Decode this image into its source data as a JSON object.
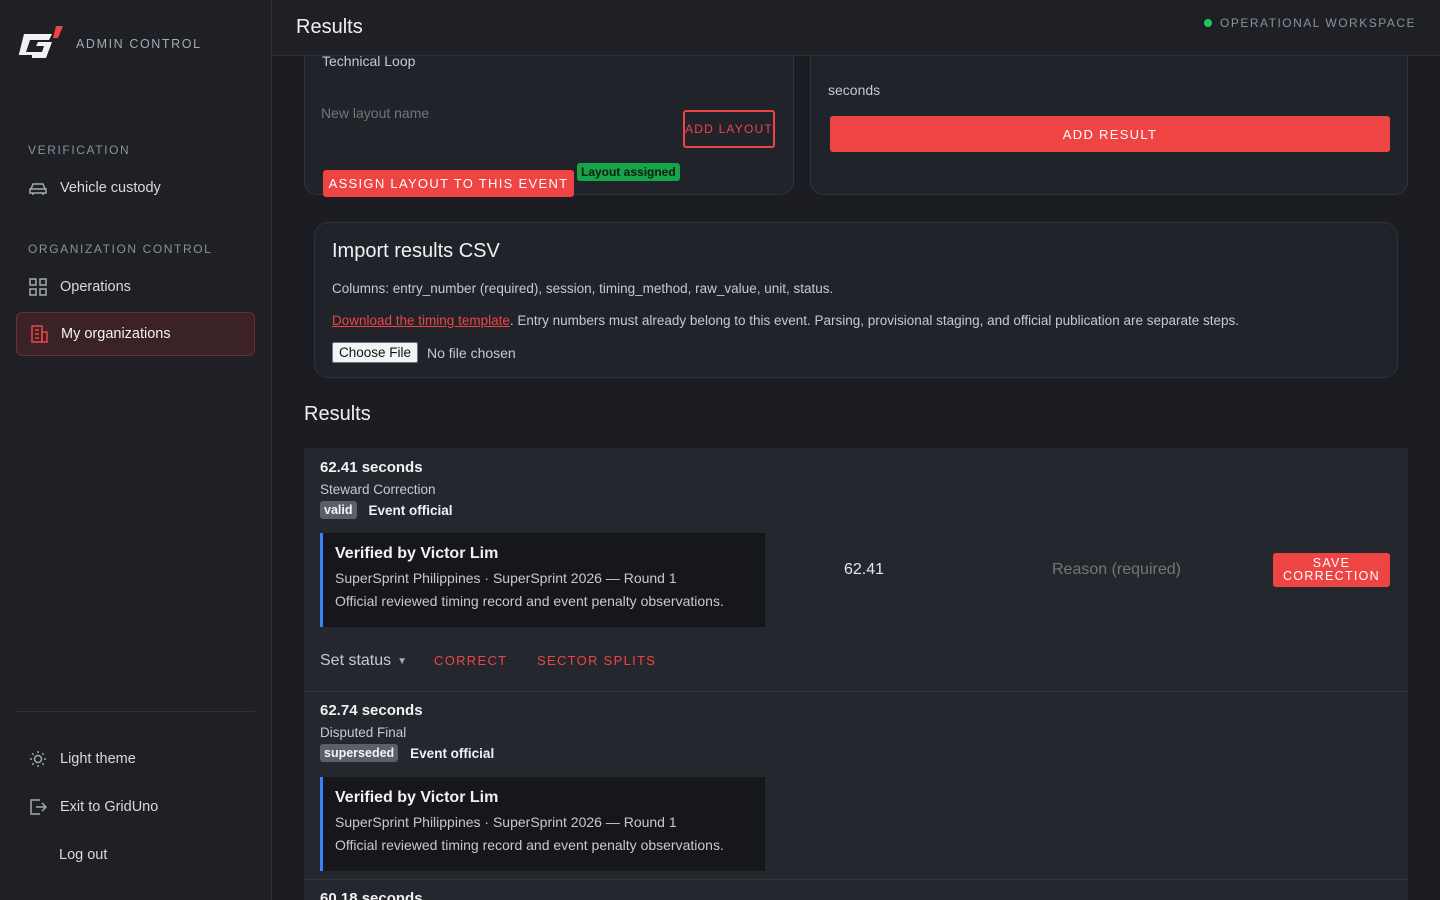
{
  "brand": {
    "text": "ADMIN CONTROL",
    "accent": "#ef4444"
  },
  "sidebar": {
    "sections": [
      {
        "label": "VERIFICATION",
        "items": [
          {
            "label": "Vehicle custody",
            "icon": "car-icon"
          }
        ]
      },
      {
        "label": "ORGANIZATION CONTROL",
        "items": [
          {
            "label": "Operations",
            "icon": "grid-icon"
          },
          {
            "label": "My organizations",
            "icon": "building-icon",
            "active": true
          }
        ]
      }
    ],
    "footer": [
      {
        "label": "Light theme",
        "icon": "sun-icon"
      },
      {
        "label": "Exit to GridUno",
        "icon": "exit-icon"
      },
      {
        "label": "Log out"
      }
    ]
  },
  "topbar": {
    "title": "Results",
    "workspace": "OPERATIONAL WORKSPACE",
    "status_color": "#22c55e"
  },
  "layout_card": {
    "current_layout": "Technical Loop",
    "new_layout_placeholder": "New layout name",
    "add_layout_label": "ADD LAYOUT",
    "assign_label": "ASSIGN LAYOUT TO THIS EVENT",
    "assigned_badge": "Layout assigned"
  },
  "result_card": {
    "unit_label": "seconds",
    "add_result_label": "ADD RESULT"
  },
  "import": {
    "title": "Import results CSV",
    "columns_text": "Columns: entry_number (required), session, timing_method, raw_value, unit, status.",
    "template_link": "Download the timing template",
    "template_note": ". Entry numbers must already belong to this event. Parsing, provisional staging, and official publication are separate steps.",
    "file_button": "Choose File",
    "file_status": "No file chosen"
  },
  "results": {
    "title": "Results",
    "items": [
      {
        "time": "62.41 seconds",
        "session": "Steward Correction",
        "status": "valid",
        "scope": "Event official",
        "verified_title": "Verified by Victor Lim",
        "verified_event": "SuperSprint Philippines · SuperSprint 2026 — Round 1",
        "verified_note": "Official reviewed timing record and event penalty observations.",
        "correction_value": "62.41",
        "reason_placeholder": "Reason (required)",
        "save_label": "SAVE CORRECTION",
        "set_status_label": "Set status",
        "correct_label": "CORRECT",
        "splits_label": "SECTOR SPLITS"
      },
      {
        "time": "62.74 seconds",
        "session": "Disputed Final",
        "status": "superseded",
        "scope": "Event official",
        "verified_title": "Verified by Victor Lim",
        "verified_event": "SuperSprint Philippines · SuperSprint 2026 — Round 1",
        "verified_note": "Official reviewed timing record and event penalty observations."
      },
      {
        "time": "60.18 seconds"
      }
    ]
  }
}
